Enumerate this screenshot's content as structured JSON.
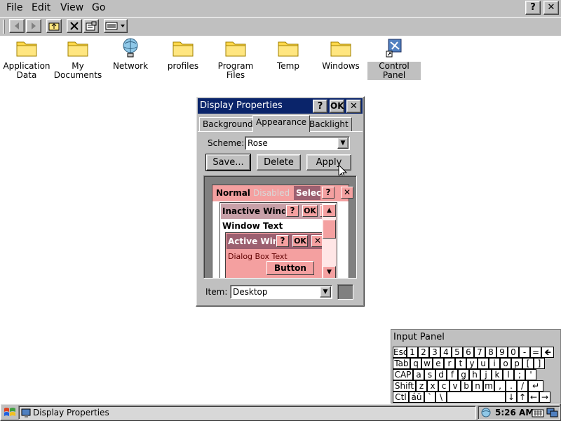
{
  "menubar": {
    "items": [
      {
        "label": "File"
      },
      {
        "label": "Edit"
      },
      {
        "label": "View"
      },
      {
        "label": "Go"
      }
    ],
    "help_label": "?",
    "close_label": "✕"
  },
  "toolbar": {
    "icons": [
      "back-arrow-icon",
      "forward-arrow-icon",
      "up-folder-icon",
      "delete-icon",
      "properties-icon",
      "view-mode-icon"
    ]
  },
  "desktop": {
    "icons": [
      {
        "label": "Application Data",
        "icon": "folder-icon"
      },
      {
        "label": "My Documents",
        "icon": "folder-icon"
      },
      {
        "label": "Network",
        "icon": "network-icon"
      },
      {
        "label": "profiles",
        "icon": "folder-icon"
      },
      {
        "label": "Program Files",
        "icon": "folder-icon"
      },
      {
        "label": "Temp",
        "icon": "folder-icon"
      },
      {
        "label": "Windows",
        "icon": "folder-icon"
      },
      {
        "label": "Control Panel",
        "icon": "control-panel-icon",
        "selected": true
      }
    ]
  },
  "dialog": {
    "title": "Display Properties",
    "help_label": "?",
    "ok_label": "OK",
    "close_label": "✕",
    "tabs": [
      {
        "label": "Background"
      },
      {
        "label": "Appearance",
        "active": true
      },
      {
        "label": "Backlight"
      }
    ],
    "scheme_label": "Scheme:",
    "scheme_value": "Rose",
    "buttons": {
      "save": "Save...",
      "delete": "Delete",
      "apply": "Apply"
    },
    "preview": {
      "normal": "Normal",
      "disabled": "Disabled",
      "selected": "Selec",
      "inactive_window": "Inactive Wind",
      "window_text": "Window Text",
      "active_window": "Active Win",
      "dialog_box_text": "Dialog Box Text",
      "button": "Button",
      "help": "?",
      "ok": "OK",
      "close": "✕",
      "scroll_up": "▲",
      "scroll_down": "▼"
    },
    "item_label": "Item:",
    "item_value": "Desktop"
  },
  "input_panel": {
    "title": "Input Panel",
    "rows": [
      [
        "Esc",
        "1",
        "2",
        "3",
        "4",
        "5",
        "6",
        "7",
        "8",
        "9",
        "0",
        "-",
        "=",
        "🡸"
      ],
      [
        "Tab",
        "q",
        "w",
        "e",
        "r",
        "t",
        "y",
        "u",
        "i",
        "o",
        "p",
        "[",
        "]"
      ],
      [
        "CAP",
        "a",
        "s",
        "d",
        "f",
        "g",
        "h",
        "j",
        "k",
        "l",
        ";",
        "'"
      ],
      [
        "Shift",
        "z",
        "x",
        "c",
        "v",
        "b",
        "n",
        "m",
        ",",
        ".",
        "/",
        "↵"
      ],
      [
        "Ctl",
        "áü",
        "`",
        "\\",
        "",
        "↓",
        "↑",
        "←",
        "→"
      ]
    ]
  },
  "taskbar": {
    "task_label": "Display Properties",
    "time": "5:26 AM"
  },
  "colors": {
    "titlebar": "#0a246a",
    "rose_light": "#f4a0a0",
    "rose_dark": "#9c6070",
    "face": "#c0c0c0"
  }
}
